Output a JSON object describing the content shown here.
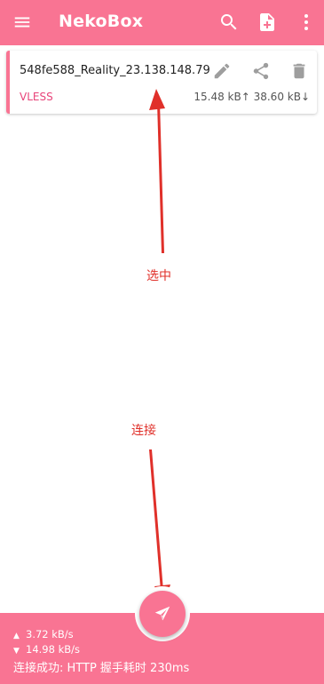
{
  "appbar": {
    "title": "NekoBox",
    "icons": [
      "menu-icon",
      "search-icon",
      "add-file-icon",
      "more-vert-icon"
    ]
  },
  "profile": {
    "name": "548fe588_Reality_23.138.148.79",
    "protocol": "VLESS",
    "traffic": "15.48 kB↑ 38.60 kB↓",
    "actions": [
      "edit-icon",
      "share-icon",
      "delete-icon"
    ]
  },
  "annotations": {
    "select_label": "选中",
    "connect_label": "连接",
    "color": "#e0302a"
  },
  "status": {
    "up_arrow": "▲",
    "up_speed": "3.72 kB/s",
    "down_arrow": "▼",
    "down_speed": "14.98 kB/s",
    "message": "连接成功: HTTP 握手耗时 230ms"
  },
  "colors": {
    "accent": "#f97493",
    "protocol_text": "#e8447a",
    "background": "#ffffff"
  }
}
